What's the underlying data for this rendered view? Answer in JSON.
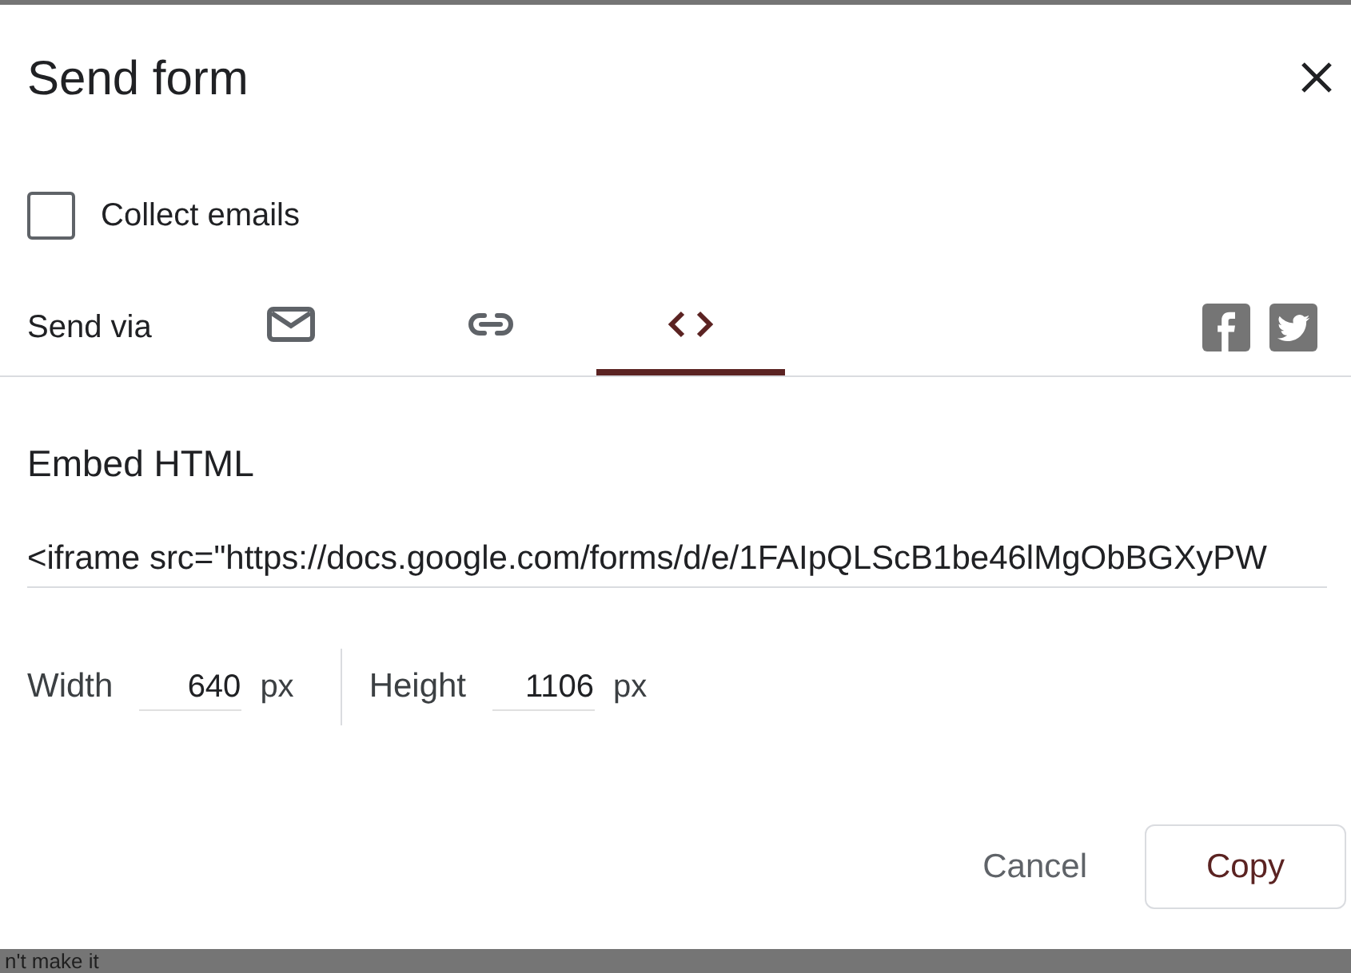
{
  "dialog": {
    "title": "Send form"
  },
  "collect_emails": {
    "label": "Collect emails",
    "checked": false
  },
  "send_via": {
    "label": "Send via",
    "tabs": [
      {
        "kind": "email",
        "selected": false
      },
      {
        "kind": "link",
        "selected": false
      },
      {
        "kind": "embed",
        "selected": true
      }
    ]
  },
  "embed": {
    "heading": "Embed HTML",
    "code": "<iframe src=\"https://docs.google.com/forms/d/e/1FAIpQLScB1be46lMgObBGXyPW",
    "width": {
      "label": "Width",
      "value": "640",
      "unit": "px"
    },
    "height": {
      "label": "Height",
      "value": "1106",
      "unit": "px"
    }
  },
  "buttons": [
    {
      "label": "Cancel",
      "kind": "text"
    },
    {
      "label": "Copy",
      "kind": "outlined"
    }
  ],
  "background_text": "n't make it"
}
